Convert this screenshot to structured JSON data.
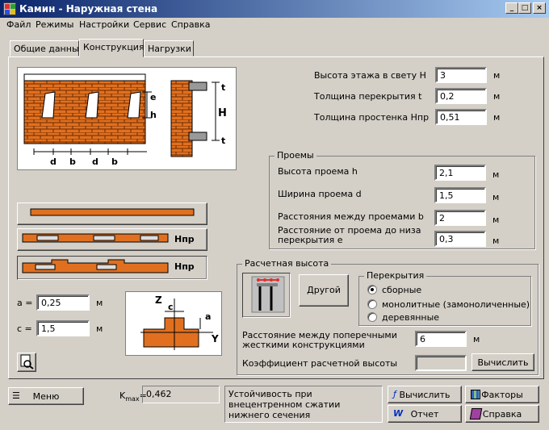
{
  "window": {
    "title": "Камин - Наружная стена",
    "min": "_",
    "max": "□",
    "close": "×"
  },
  "menu": [
    "Файл",
    "Режимы",
    "Настройки",
    "Сервис",
    "Справка"
  ],
  "tabs": [
    "Общие данные",
    "Конструкция",
    "Нагрузки"
  ],
  "main_params": [
    {
      "label": "Высота этажа в свету H",
      "value": "3",
      "unit": "м"
    },
    {
      "label": "Толщина перекрытия t",
      "value": "0,2",
      "unit": "м"
    },
    {
      "label": "Толщина простенка Hпр",
      "value": "0,51",
      "unit": "м"
    }
  ],
  "openings": {
    "title": "Проемы",
    "rows": [
      {
        "label": "Высота проема h",
        "value": "2,1",
        "unit": "м"
      },
      {
        "label": "Ширина проема d",
        "value": "1,5",
        "unit": "м"
      },
      {
        "label": "Расстояния между проемами b",
        "value": "2",
        "unit": "м"
      },
      {
        "label": "Расстояние от проема до низа перекрытия e",
        "value": "0,3",
        "unit": "м"
      }
    ]
  },
  "design_height": {
    "title": "Расчетная высота",
    "other_button": "Другой",
    "floors": {
      "title": "Перекрытия",
      "options": [
        "сборные",
        "монолитные (замоноличенные)",
        "деревянные"
      ],
      "selected": 0
    },
    "distance_label": "Расстояние между поперечными жесткими конструкциями",
    "distance_value": "6",
    "distance_unit": "м",
    "coef_label": "Коэффициент расчетной высоты",
    "coef_value": "",
    "compute_button": "Вычислить"
  },
  "section": {
    "a_label": "a =",
    "a_value": "0,25",
    "a_unit": "м",
    "c_label": "c =",
    "c_value": "1,5",
    "c_unit": "м"
  },
  "figure_labels": {
    "e": "e",
    "h": "h",
    "H": "H",
    "t": "t",
    "d": "d",
    "b": "b",
    "Hpr": "Hпр",
    "Z": "Z",
    "Y": "Y",
    "c": "c",
    "a": "a"
  },
  "bottom": {
    "menu_button": "Меню",
    "kmax_label": "K",
    "kmax_sub": "max",
    "kmax_eq": "=",
    "kmax_value": "0,462",
    "status": "Устойчивость при внецентренном сжатии нижнего сечения",
    "compute": "Вычислить",
    "factors": "Факторы",
    "report": "Отчет",
    "help": "Справка"
  },
  "colors": {
    "brick": "#e07020",
    "titlebar": "#0a246a"
  }
}
